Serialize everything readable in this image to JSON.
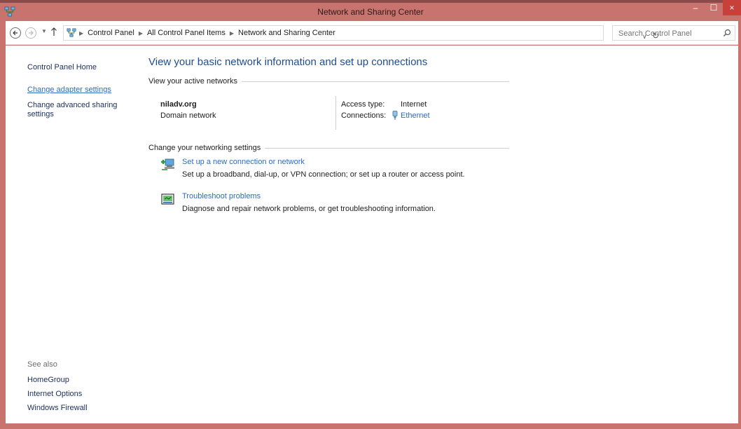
{
  "window": {
    "title": "Network and Sharing Center",
    "controls": {
      "minimize": "–",
      "maximize": "☐",
      "close": "×"
    }
  },
  "navigation": {
    "back_icon": "back-arrow-icon",
    "forward_icon": "forward-arrow-icon",
    "up_icon": "up-arrow-icon",
    "breadcrumb": [
      "Control Panel",
      "All Control Panel Items",
      "Network and Sharing Center"
    ],
    "search_placeholder": "Search Control Panel"
  },
  "sidebar": {
    "home": "Control Panel Home",
    "adapter": "Change adapter settings",
    "advanced": "Change advanced sharing settings",
    "see_also_label": "See also",
    "see_also": [
      "HomeGroup",
      "Internet Options",
      "Windows Firewall"
    ]
  },
  "main": {
    "title": "View your basic network information and set up connections",
    "active_section": "View your active networks",
    "network": {
      "name": "niladv.org",
      "type": "Domain network",
      "access_label": "Access type:",
      "access_value": "Internet",
      "connections_label": "Connections:",
      "connection_name": "Ethernet"
    },
    "change_section": "Change your networking settings",
    "tasks": [
      {
        "title": "Set up a new connection or network",
        "description": "Set up a broadband, dial-up, or VPN connection; or set up a router or access point."
      },
      {
        "title": "Troubleshoot problems",
        "description": "Diagnose and repair network problems, or get troubleshooting information."
      }
    ]
  },
  "colors": {
    "titlebar": "#c8736e",
    "close_button": "#c7403a",
    "link": "#2c6cc1",
    "heading": "#1e4d8f"
  }
}
